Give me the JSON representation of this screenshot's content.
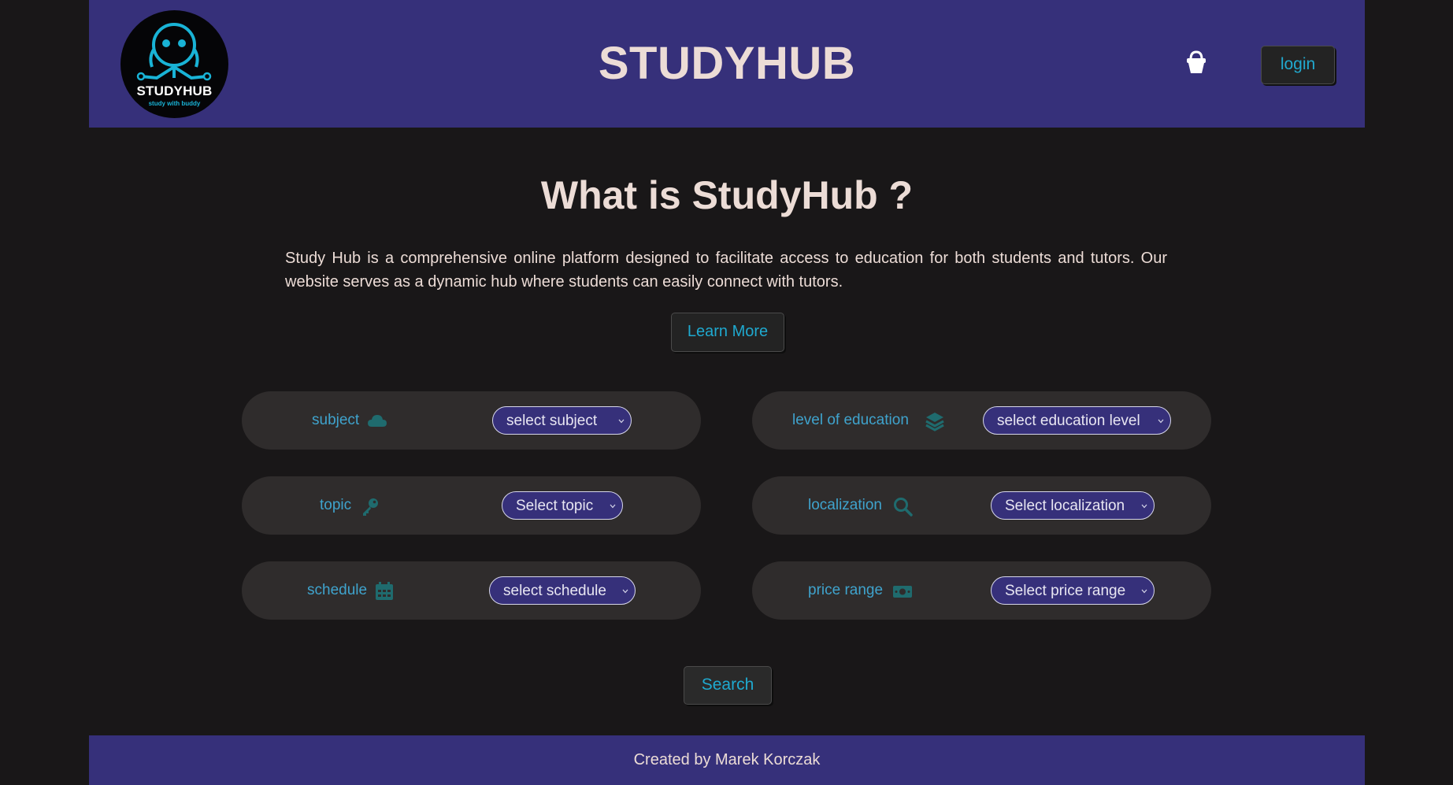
{
  "header": {
    "logo": {
      "title": "STUDYHUB",
      "subtitle": "study with buddy"
    },
    "title": "STUDYHUB",
    "cart_icon": "shopping-basket-icon",
    "login_label": "login"
  },
  "main": {
    "heading": "What is StudyHub ?",
    "intro": "Study Hub is a comprehensive online platform designed to facilitate access to education for both students and tutors. Our website serves as a dynamic hub where students can easily connect with tutors.",
    "learn_more_label": "Learn More"
  },
  "filters": {
    "subject": {
      "label": "subject",
      "icon": "cloud-icon",
      "value": "select subject"
    },
    "education": {
      "label": "level of education",
      "icon": "layers-icon",
      "value": "select education level"
    },
    "topic": {
      "label": "topic",
      "icon": "key-icon",
      "value": "Select topic"
    },
    "localization": {
      "label": "localization",
      "icon": "search-icon",
      "value": "Select localization"
    },
    "schedule": {
      "label": "schedule",
      "icon": "calendar-icon",
      "value": "select schedule"
    },
    "price": {
      "label": "price range",
      "icon": "money-icon",
      "value": "Select price range"
    }
  },
  "search_label": "Search",
  "footer": {
    "text": "Created by Marek Korczak"
  },
  "colors": {
    "background": "#191718",
    "header": "#36307a",
    "accent": "#1fa9cf",
    "card": "#2f2c2c",
    "text": "#ecdcd6",
    "icon": "#1f6b6e"
  }
}
